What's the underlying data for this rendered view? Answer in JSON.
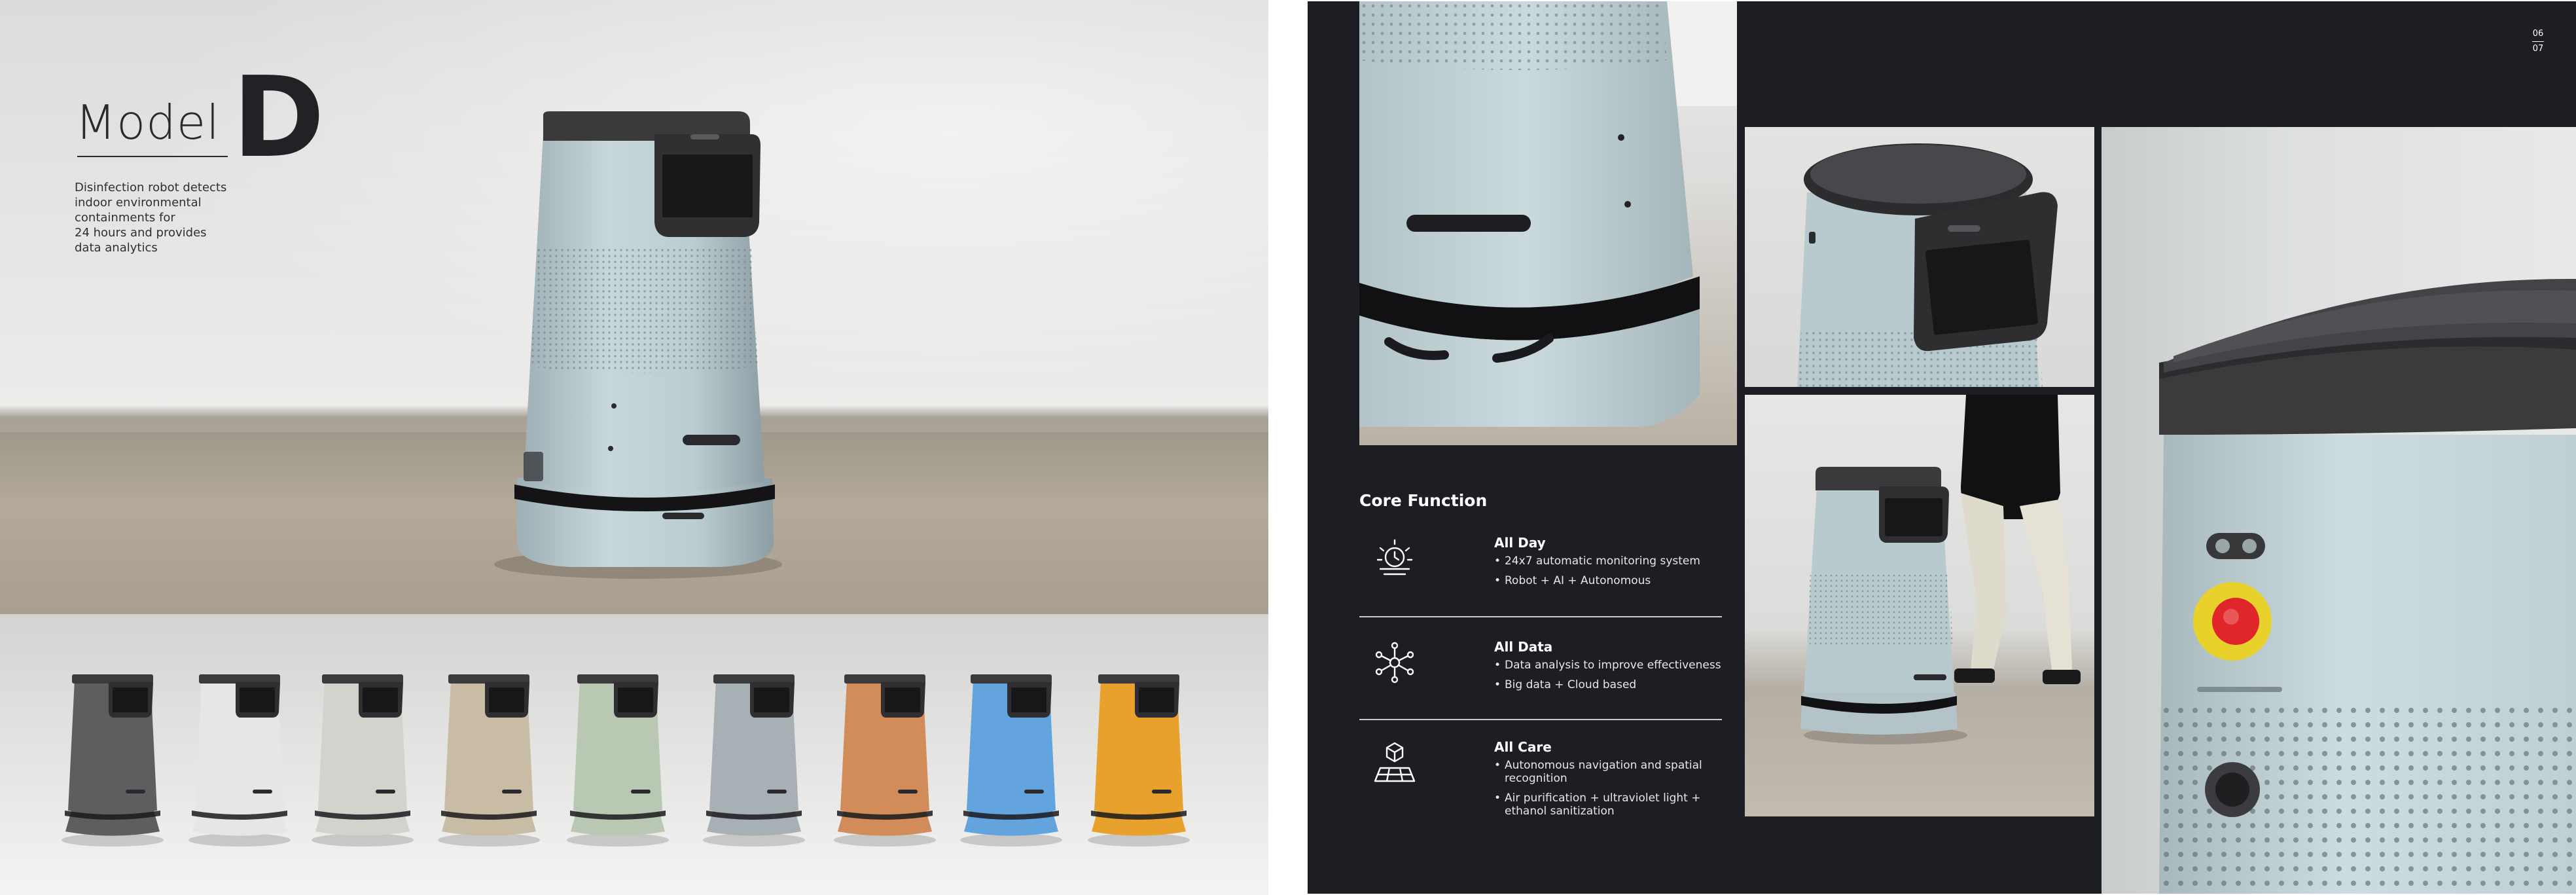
{
  "left_page": {
    "model_word": "Model",
    "model_letter": "D",
    "description": "Disinfection robot detects\nindoor environmental\ncontainments for\n24 hours and provides\ndata analytics",
    "lineup_colors": [
      "#5e5e60",
      "#e6e6e4",
      "#d4d2cd",
      "#c9bca4",
      "#b9c8b2",
      "#a6b0b5",
      "#d28c5a",
      "#63a4de",
      "#e7a12c"
    ]
  },
  "right_page": {
    "page_number": {
      "top": "06",
      "bottom": "07"
    },
    "core_function": {
      "title": "Core Function",
      "features": [
        {
          "icon": "sun-clock-icon",
          "name": "All Day",
          "bullets": [
            "24x7 automatic monitoring system",
            "Robot + AI + Autonomous"
          ]
        },
        {
          "icon": "network-nodes-icon",
          "name": "All Data",
          "bullets": [
            "Data analysis to improve effectiveness",
            "Big data + Cloud based"
          ]
        },
        {
          "icon": "cube-grid-icon",
          "name": "All Care",
          "bullets": [
            "Autonomous navigation and spatial recognition",
            "Air purification + ultraviolet light + ethanol sanitization"
          ]
        }
      ]
    }
  },
  "colors": {
    "robot_body": "#bcccd0",
    "robot_top": "#3b3b3e",
    "dark_bg": "#1d1d24",
    "button_red": "#e0262b",
    "button_yellow": "#e8d12a"
  }
}
